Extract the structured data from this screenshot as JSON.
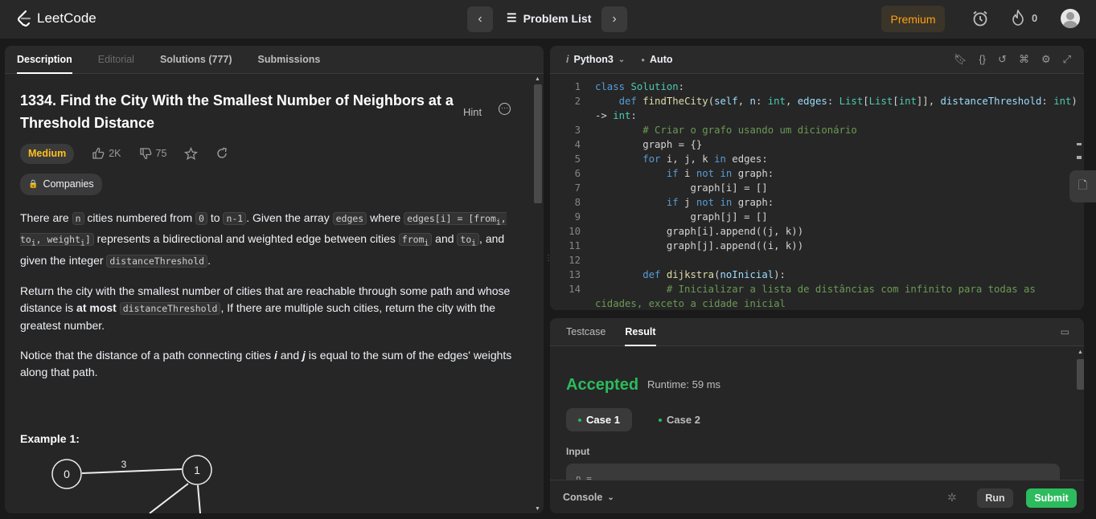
{
  "app": {
    "logo_text": "LeetCode"
  },
  "header": {
    "prev_icon": "chevron-left-icon",
    "next_icon": "chevron-right-icon",
    "problem_list_label": "Problem List",
    "premium_label": "Premium",
    "streak_count": "0",
    "accent": "#ffa116"
  },
  "left_tabs": [
    {
      "label": "Description"
    },
    {
      "label": "Editorial"
    },
    {
      "label": "Solutions (777)"
    },
    {
      "label": "Submissions"
    }
  ],
  "problem": {
    "title": "1334. Find the City With the Smallest Number of Neighbors at a Threshold Distance",
    "hint_label": "Hint",
    "difficulty": "Medium",
    "likes": "2K",
    "dislikes": "75",
    "companies_label": "Companies",
    "example_label": "Example 1:"
  },
  "graph": {
    "nodes": [
      "0",
      "1"
    ],
    "edge_weight": "3"
  },
  "editor": {
    "language": "Python3",
    "mode": "Auto",
    "lines": [
      "1",
      "2",
      "",
      "3",
      "4",
      "5",
      "6",
      "7",
      "8",
      "9",
      "10",
      "11",
      "12",
      "13",
      "14"
    ]
  },
  "result_tabs": [
    {
      "label": "Testcase"
    },
    {
      "label": "Result"
    }
  ],
  "result": {
    "status": "Accepted",
    "runtime": "Runtime: 59 ms",
    "case1": "Case 1",
    "case2": "Case 2",
    "input_label": "Input",
    "input_value": "n =",
    "console_label": "Console",
    "run_label": "Run",
    "submit_label": "Submit",
    "accepted_color": "#2cbb5d"
  }
}
